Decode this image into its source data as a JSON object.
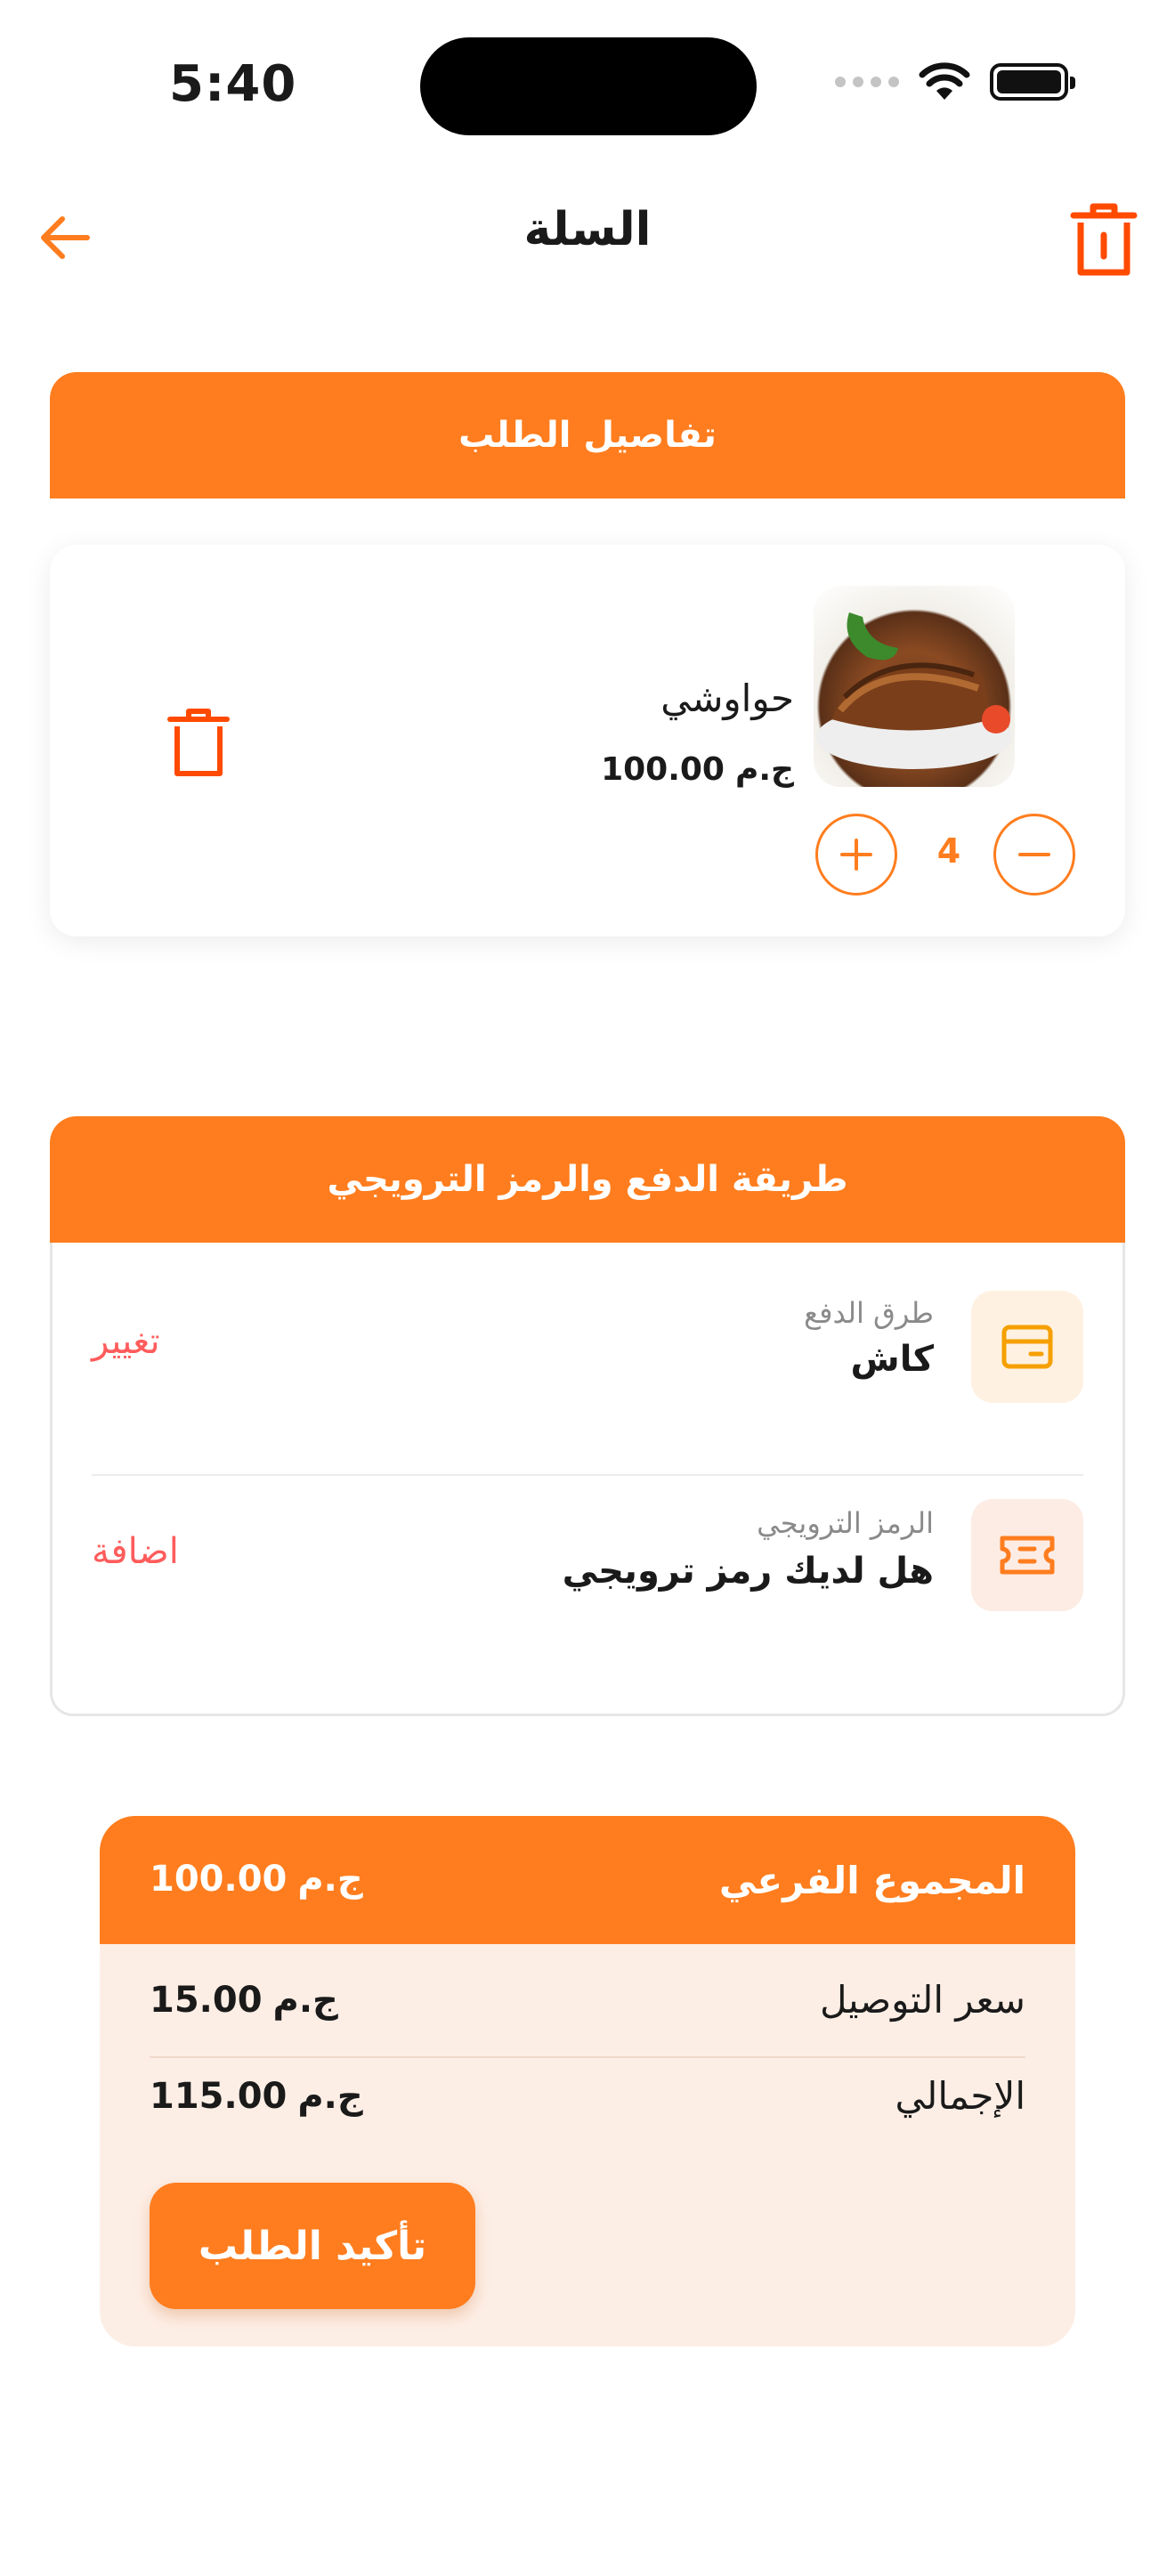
{
  "status_bar": {
    "time": "5:40"
  },
  "header": {
    "title": "السلة"
  },
  "order_section": {
    "title": "تفاصيل الطلب"
  },
  "cart_item": {
    "name": "حواوشي",
    "price": "100.00",
    "currency": "ج.م",
    "quantity": "4"
  },
  "payment_section": {
    "title": "طريقة الدفع والرمز الترويجي",
    "payment_method": {
      "label": "طرق الدفع",
      "value": "كاش",
      "action": "تغيير"
    },
    "promo_code": {
      "label": "الرمز الترويجي",
      "value": "هل لديك رمز ترويجي",
      "action": "اضافة"
    }
  },
  "summary": {
    "subtotal": {
      "label": "المجموع الفرعي",
      "value": "100.00",
      "currency": "ج.م"
    },
    "delivery": {
      "label": "سعر التوصيل",
      "value": "15.00",
      "currency": "ج.م"
    },
    "total": {
      "label": "الإجمالي",
      "value": "115.00",
      "currency": "ج.م"
    },
    "confirm_label": "تأكيد الطلب"
  },
  "icons": {
    "back": "arrow-left-icon",
    "trash": "trash-icon",
    "plus": "plus-icon",
    "minus": "minus-icon",
    "wallet": "wallet-icon",
    "ticket": "ticket-icon"
  },
  "colors": {
    "accent": "#ff7d1e",
    "danger": "#ff5c5c",
    "trash_red": "#ff4a00",
    "summary_bg": "#fdeee5"
  }
}
